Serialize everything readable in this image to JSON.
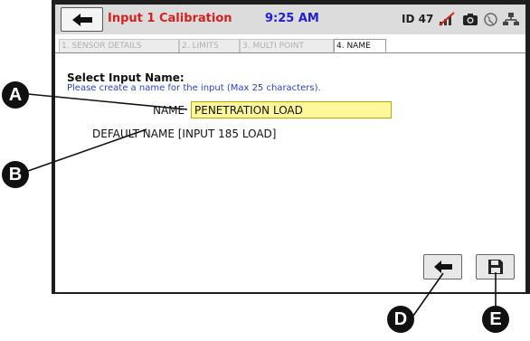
{
  "header": {
    "title": "Input 1 Calibration",
    "time": "9:25 AM",
    "id_label": "ID 47"
  },
  "tabs": [
    {
      "label": "1. SENSOR DETAILS",
      "active": false
    },
    {
      "label": "2. LIMITS",
      "active": false
    },
    {
      "label": "3. MULTI POINT",
      "active": false
    },
    {
      "label": "4. NAME",
      "active": true
    }
  ],
  "form": {
    "heading": "Select Input Name:",
    "help": "Please create a name for the input (Max 25 characters).",
    "name_label": "NAME",
    "name_value": "PENETRATION LOAD",
    "default_label": "DEFAULT NAME",
    "default_value": "[INPUT 185 LOAD]"
  },
  "callouts": {
    "a": "A",
    "b": "B",
    "d": "D",
    "e": "E"
  },
  "icons": {
    "back_top": "left-arrow-icon",
    "no_signal": "no-signal-icon",
    "camera": "camera-icon",
    "globe": "globe-icon",
    "network": "network-icon",
    "back_bottom": "left-arrow-icon",
    "save": "floppy-disk-icon"
  },
  "colors": {
    "title": "#d42020",
    "time": "#2020d0",
    "input_bg": "#fff89a",
    "help_text": "#2a3ec8"
  }
}
